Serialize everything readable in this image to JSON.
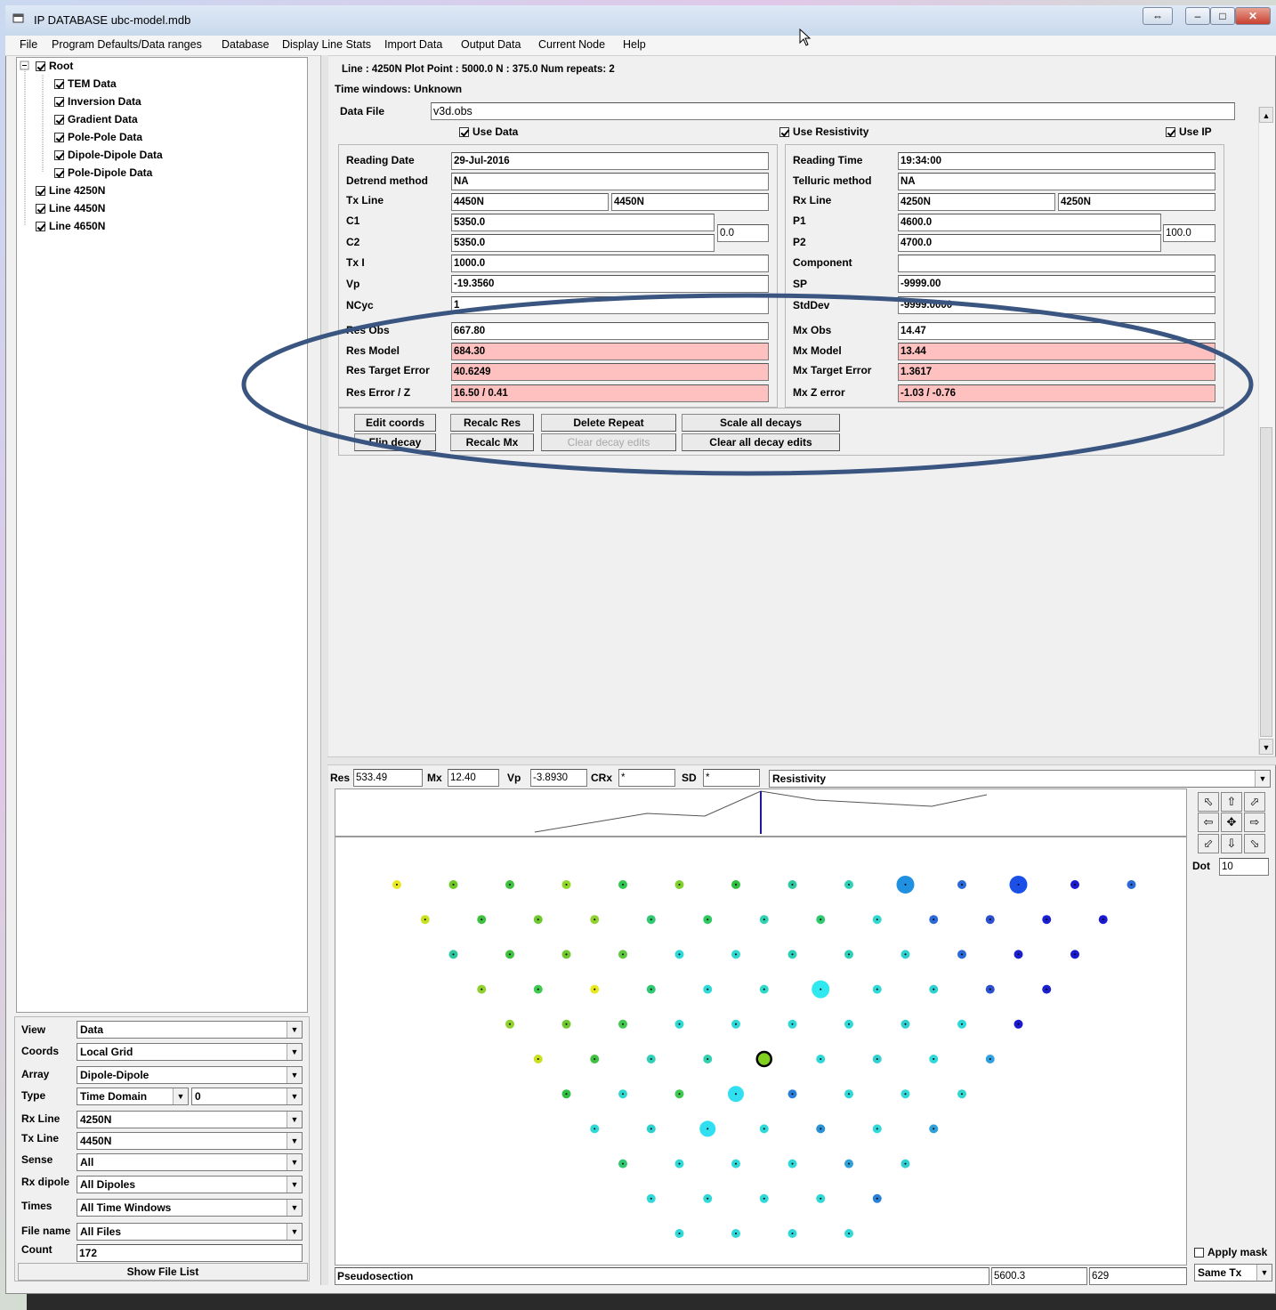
{
  "window": {
    "title": "IP DATABASE ubc-model.mdb"
  },
  "menu": [
    "File",
    "Program Defaults/Data ranges",
    "Database",
    "Display Line Stats",
    "Import Data",
    "Output Data",
    "Current Node",
    "Help"
  ],
  "tree": {
    "root": "Root",
    "children": [
      "TEM Data",
      "Inversion Data",
      "Gradient Data",
      "Pole-Pole Data",
      "Dipole-Dipole Data",
      "Pole-Dipole Data"
    ],
    "lines": [
      "Line 4250N",
      "Line 4450N",
      "Line 4650N"
    ]
  },
  "filters": [
    {
      "label": "View",
      "value": "Data"
    },
    {
      "label": "Coords",
      "value": "Local Grid"
    },
    {
      "label": "Array",
      "value": "Dipole-Dipole"
    },
    {
      "label": "Type",
      "value": "Time Domain",
      "extra": "0"
    },
    {
      "label": "Rx Line",
      "value": "4250N"
    },
    {
      "label": "Tx Line",
      "value": "4450N"
    },
    {
      "label": "Sense",
      "value": "All"
    },
    {
      "label": "Rx dipole",
      "value": "All Dipoles"
    },
    {
      "label": "Times",
      "value": "All Time Windows"
    },
    {
      "label": "File name",
      "value": "All Files"
    },
    {
      "label": "Count",
      "value": "172"
    }
  ],
  "show_file_list": "Show File List",
  "info": {
    "line_header": "Line : 4250N Plot Point : 5000.0 N : 375.0 Num repeats: 2",
    "time_windows": "Time windows: Unknown",
    "data_file_label": "Data File",
    "data_file": "v3d.obs",
    "use_data": "Use Data",
    "use_resistivity": "Use Resistivity",
    "use_ip": "Use IP"
  },
  "tx": {
    "reading_date_label": "Reading Date",
    "reading_date": "29-Jul-2016",
    "detrend_label": "Detrend method",
    "detrend": "NA",
    "txline_label": "Tx Line",
    "txline1": "4450N",
    "txline2": "4450N",
    "c1_label": "C1",
    "c1": "5350.0",
    "c2_label": "C2",
    "c2": "5350.0",
    "c_sep": "0.0",
    "txi_label": "Tx I",
    "txi": "1000.0",
    "vp_label": "Vp",
    "vp": "-19.3560",
    "ncyc_label": "NCyc",
    "ncyc": "1",
    "resobs_label": "Res Obs",
    "resobs": "667.80",
    "resmodel_label": "Res Model",
    "resmodel": "684.30",
    "restarget_label": "Res Target Error",
    "restarget": "40.6249",
    "reserror_label": "Res Error / Z",
    "reserror": "16.50  /  0.41"
  },
  "rx": {
    "reading_time_label": "Reading Time",
    "reading_time": "19:34:00",
    "telluric_label": "Telluric method",
    "telluric": "NA",
    "rxline_label": "Rx Line",
    "rxline1": "4250N",
    "rxline2": "4250N",
    "p1_label": "P1",
    "p1": "4600.0",
    "p2_label": "P2",
    "p2": "4700.0",
    "p_sep": "100.0",
    "component_label": "Component",
    "component": "",
    "sp_label": "SP",
    "sp": "-9999.00",
    "stddev_label": "StdDev",
    "stddev": "-9999.0000",
    "mxobs_label": "Mx Obs",
    "mxobs": "14.47",
    "mxmodel_label": "Mx Model",
    "mxmodel": "13.44",
    "mxtarget_label": "Mx Target Error",
    "mxtarget": "1.3617",
    "mxz_label": "Mx Z error",
    "mxz": "-1.03  /  -0.76"
  },
  "buttons": {
    "edit_coords": "Edit coords",
    "recalc_res": "Recalc Res",
    "delete_repeat": "Delete Repeat",
    "scale_all": "Scale all  decays",
    "flip_decay": "Flip decay",
    "recalc_mx": "Recalc Mx",
    "clear_decay": "Clear decay edits",
    "clear_all_decay": "Clear all decay edits"
  },
  "stats": {
    "res_label": "Res",
    "res": "533.49",
    "mx_label": "Mx",
    "mx": "12.40",
    "vp_label": "Vp",
    "vp": "-3.8930",
    "crx_label": "CRx",
    "crx": "*",
    "sd_label": "SD",
    "sd": "*",
    "mode": "Resistivity"
  },
  "side": {
    "dot_label": "Dot",
    "dot": "10",
    "apply_mask": "Apply mask",
    "same_tx": "Same Tx"
  },
  "status": {
    "label": "Pseudosection",
    "coord": "5600.3",
    "value": "629"
  },
  "colors": {
    "highlight": "#ffc0c0",
    "ellipse": "#3a5580",
    "marker": "#1a1aa0"
  }
}
